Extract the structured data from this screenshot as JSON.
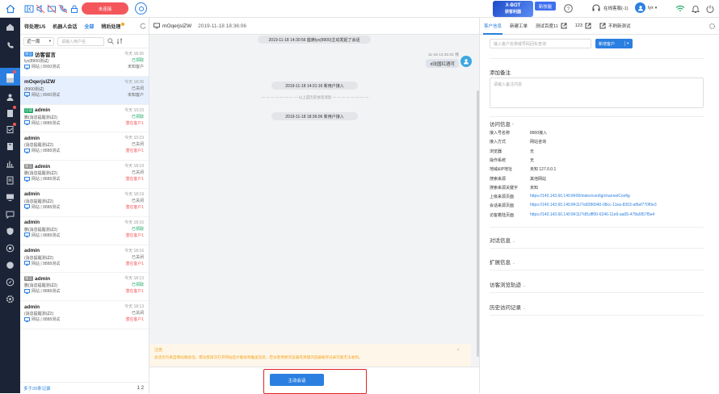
{
  "topbar": {
    "status_label": "未连接",
    "promo1_title": "X-BOT",
    "promo1_sub": "获客利器",
    "promo2": "新技能",
    "agent_status": "在线客服(-1)",
    "user": "lyx"
  },
  "sessions": {
    "tabs": [
      "待处理1/5",
      "机器人会话",
      "全部",
      "稍后处理"
    ],
    "filter_range": "近一周",
    "search_placeholder": "请输入用户名",
    "items": [
      {
        "tag": "留言",
        "tag_color": "#3b8fe8",
        "name": "访客留言",
        "sub": "lyx(8900测试)",
        "src": "网站 | 8900测试",
        "time": "今天 18:36",
        "state": "已领取",
        "state_color": "#17a663",
        "ct": "未知客户",
        "ct_color": "#666"
      },
      {
        "tag": "",
        "name": "mOqerjslZW",
        "sub": "(8900测试)",
        "src": "网站 | 8900测试",
        "time": "今天 18:36",
        "state": "已关闭",
        "state_color": "#666",
        "ct": "未知客户",
        "ct_color": "#666"
      },
      {
        "tag": "已读",
        "tag_color": "#17a663",
        "name": "admin",
        "sub": "删(消息提醒测试2)",
        "src": "网站 | 8888测试",
        "time": "今天 10:23",
        "state": "已领取",
        "state_color": "#17a663",
        "ct": "潜在客户1",
        "ct_color": "#f4575b"
      },
      {
        "tag": "",
        "name": "admin",
        "sub": "(消息提醒测试2)",
        "src": "网站 | 8888测试",
        "time": "今天 10:23",
        "state": "已关闭",
        "state_color": "#666",
        "ct": "潜在客户1",
        "ct_color": "#f4575b"
      },
      {
        "tag": "留言",
        "tag_color": "#888",
        "name": "admin",
        "sub": "删(消息提醒测试2)",
        "src": "网站 | 8888测试",
        "time": "今天 18:19",
        "state": "已关闭",
        "state_color": "#666",
        "ct": "潜在客户1",
        "ct_color": "#f4575b"
      },
      {
        "tag": "",
        "name": "admin",
        "sub": "(消息提醒测试2)",
        "src": "网站 | 8888测试",
        "time": "今天 18:19",
        "state": "已关闭",
        "state_color": "#666",
        "ct": "潜在客户1",
        "ct_color": "#f4575b"
      },
      {
        "tag": "",
        "name": "admin",
        "sub": "删(消息提醒测试2)",
        "src": "网站 | 8888测试",
        "time": "今天 18:16",
        "state": "已领取",
        "state_color": "#17a663",
        "ct": "潜在客户1",
        "ct_color": "#f4575b"
      },
      {
        "tag": "",
        "name": "admin",
        "sub": "(消息提醒测试2)",
        "src": "网站 | 8888测试",
        "time": "今天 18:16",
        "state": "已关闭",
        "state_color": "#666",
        "ct": "潜在客户1",
        "ct_color": "#f4575b"
      },
      {
        "tag": "留言",
        "tag_color": "#888",
        "name": "admin",
        "sub": "删(消息提醒测试2)",
        "src": "网站 | 8888测试",
        "time": "今天 18:13",
        "state": "已领取",
        "state_color": "#17a663",
        "ct": "潜在客户1",
        "ct_color": "#f4575b"
      },
      {
        "tag": "",
        "name": "admin",
        "sub": "(消息提醒测试2)",
        "src": "网站 | 8888测试",
        "time": "今天 18:13",
        "state": "已关闭",
        "state_color": "#666",
        "ct": "潜在客户1",
        "ct_color": "#f4575b"
      }
    ],
    "more_link": "多于20条记录",
    "pages": "1    2"
  },
  "chat": {
    "title": "mOqerjslZW",
    "time": "2019-11-18 18:36:06",
    "sys1": "2019-11-18 14:30:56 座席lyx(8900)主动发起了会话",
    "msg_time": "11-18 14:31:01 我",
    "msg_text": "d法国红酒可",
    "sys2": "2019-11-18 14:31:16 新用户接入",
    "divider": "以上是历史会话消息",
    "sys3": "2019-11-18 18:36:06 新用户接入",
    "notice_title": "注意",
    "notice_text": "会话仅为来自网站端会话，需访客再次打开网站后才能收到推送消息，若访客更换浏览器或清理浏览器缓存记录可能无法收到。",
    "active_btn": "主动会话"
  },
  "panel": {
    "tabs": [
      "客户信息",
      "新建工单",
      "测试百度11",
      "123",
      "不刷新测试"
    ],
    "search_placeholder": "输入客户名称或号码回车查询",
    "new_btn": "新增客户",
    "add_note": "添加备注",
    "note_placeholder": "请输入备注内容",
    "visit_title": "访问信息",
    "visit": [
      {
        "k": "接入号名称",
        "v": "8900接入"
      },
      {
        "k": "接入方式",
        "v": "网站咨询"
      },
      {
        "k": "浏览器",
        "v": "无"
      },
      {
        "k": "操作系统",
        "v": "无"
      },
      {
        "k": "地域&IP地址",
        "v": "未知 127.0.0.1"
      },
      {
        "k": "搜索来源",
        "v": "其他网站"
      },
      {
        "k": "搜索来源关键字",
        "v": "未知"
      },
      {
        "k": "上级来源页面",
        "v": "https://140.143.60.140:8400/index/config/channelConfig",
        "link": true
      },
      {
        "k": "会话来源页面",
        "v": "https://140.143.60.140:8411/?e8286040-08cc-11ea-8353-af6ef770f0e3",
        "link": true
      },
      {
        "k": "访客着陆页面",
        "v": "https://140.143.60.140:8411/?df1dff00-6246-11e9-aa05-478a5f57f5e4",
        "link": true
      }
    ],
    "sections": [
      "对话信息",
      "扩展信息",
      "访客浏览轨迹",
      "历史访问记录"
    ]
  }
}
